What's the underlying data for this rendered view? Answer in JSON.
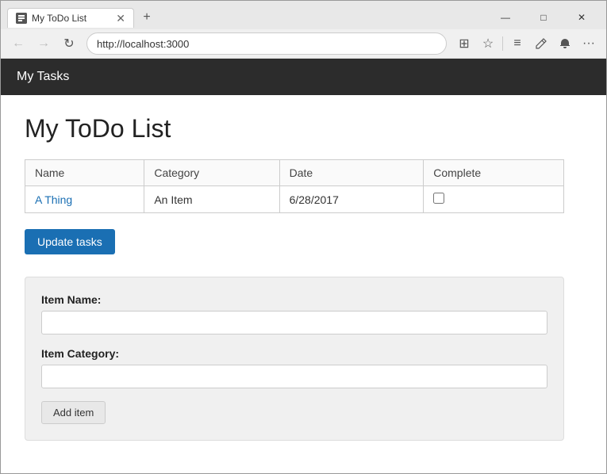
{
  "browser": {
    "tab_title": "My ToDo List",
    "url": "http://localhost:3000",
    "new_tab_icon": "+",
    "back_icon": "←",
    "forward_icon": "→",
    "reload_icon": "↻",
    "minimize_icon": "—",
    "maximize_icon": "□",
    "close_icon": "✕",
    "reader_icon": "⊞",
    "star_icon": "☆",
    "menu_icon": "≡",
    "edit_icon": "✎",
    "bell_icon": "🔔",
    "more_icon": "···"
  },
  "app": {
    "header": "My Tasks",
    "page_title": "My ToDo List",
    "table": {
      "columns": [
        "Name",
        "Category",
        "Date",
        "Complete"
      ],
      "rows": [
        {
          "name": "A Thing",
          "category": "An Item",
          "date": "6/28/2017",
          "complete": false
        }
      ]
    },
    "update_button": "Update tasks",
    "form": {
      "item_name_label": "Item Name:",
      "item_name_placeholder": "",
      "item_category_label": "Item Category:",
      "item_category_placeholder": "",
      "add_button": "Add item"
    }
  }
}
